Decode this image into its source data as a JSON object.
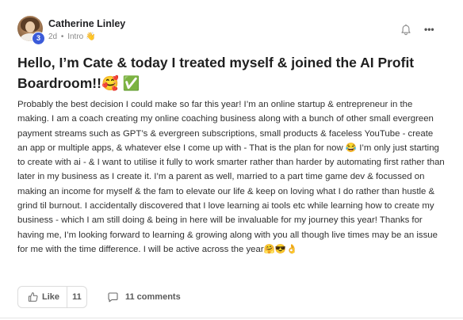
{
  "post": {
    "author": {
      "name": "Catherine Linley",
      "level": "3"
    },
    "meta": {
      "time": "2d",
      "separator": "•",
      "category": "Intro",
      "category_emoji": "👋"
    },
    "title": "Hello, I’m Cate & today I treated myself & joined the AI Profit Boardroom!!🥰 ✅",
    "body": "Probably the best decision I could make so far this year! I’m an online startup & entrepreneur in the making. I am a coach creating my online coaching business along with a bunch of other small evergreen payment streams such as GPT’s & evergreen subscriptions, small products & faceless YouTube - create an app or multiple apps, & whatever else I come up with - That is the plan for now 😂 I’m only just starting to create with ai - & I want to utilise it fully to work smarter rather than harder by automating first rather than later in my business as I create it. I’m a parent as well, married to a part time game dev & focussed on making an income for myself & the fam to elevate our life & keep on loving what I do rather than hustle & grind til burnout. I accidentally discovered that I love learning ai tools etc while learning how to create my business - which I am still doing & being in here will be invaluable for my journey this year! Thanks for having me, I’m looking forward to learning & growing along with you all though live times may be an issue for me with the time difference. I will be active across the year🤗😎👌",
    "actions": {
      "like_label": "Like",
      "like_count": "11",
      "comments_label": "11 comments"
    }
  },
  "icons": {
    "notify": "bell-icon",
    "more": "more-options-icon",
    "like": "thumbs-up-icon",
    "comment": "comment-bubble-icon"
  },
  "colors": {
    "level_badge": "#3b5bd9",
    "text_primary": "#1f1f1f",
    "text_muted": "#8a8a8a",
    "border": "#dcdcdc"
  },
  "ui": {
    "more_glyph": "•••"
  }
}
